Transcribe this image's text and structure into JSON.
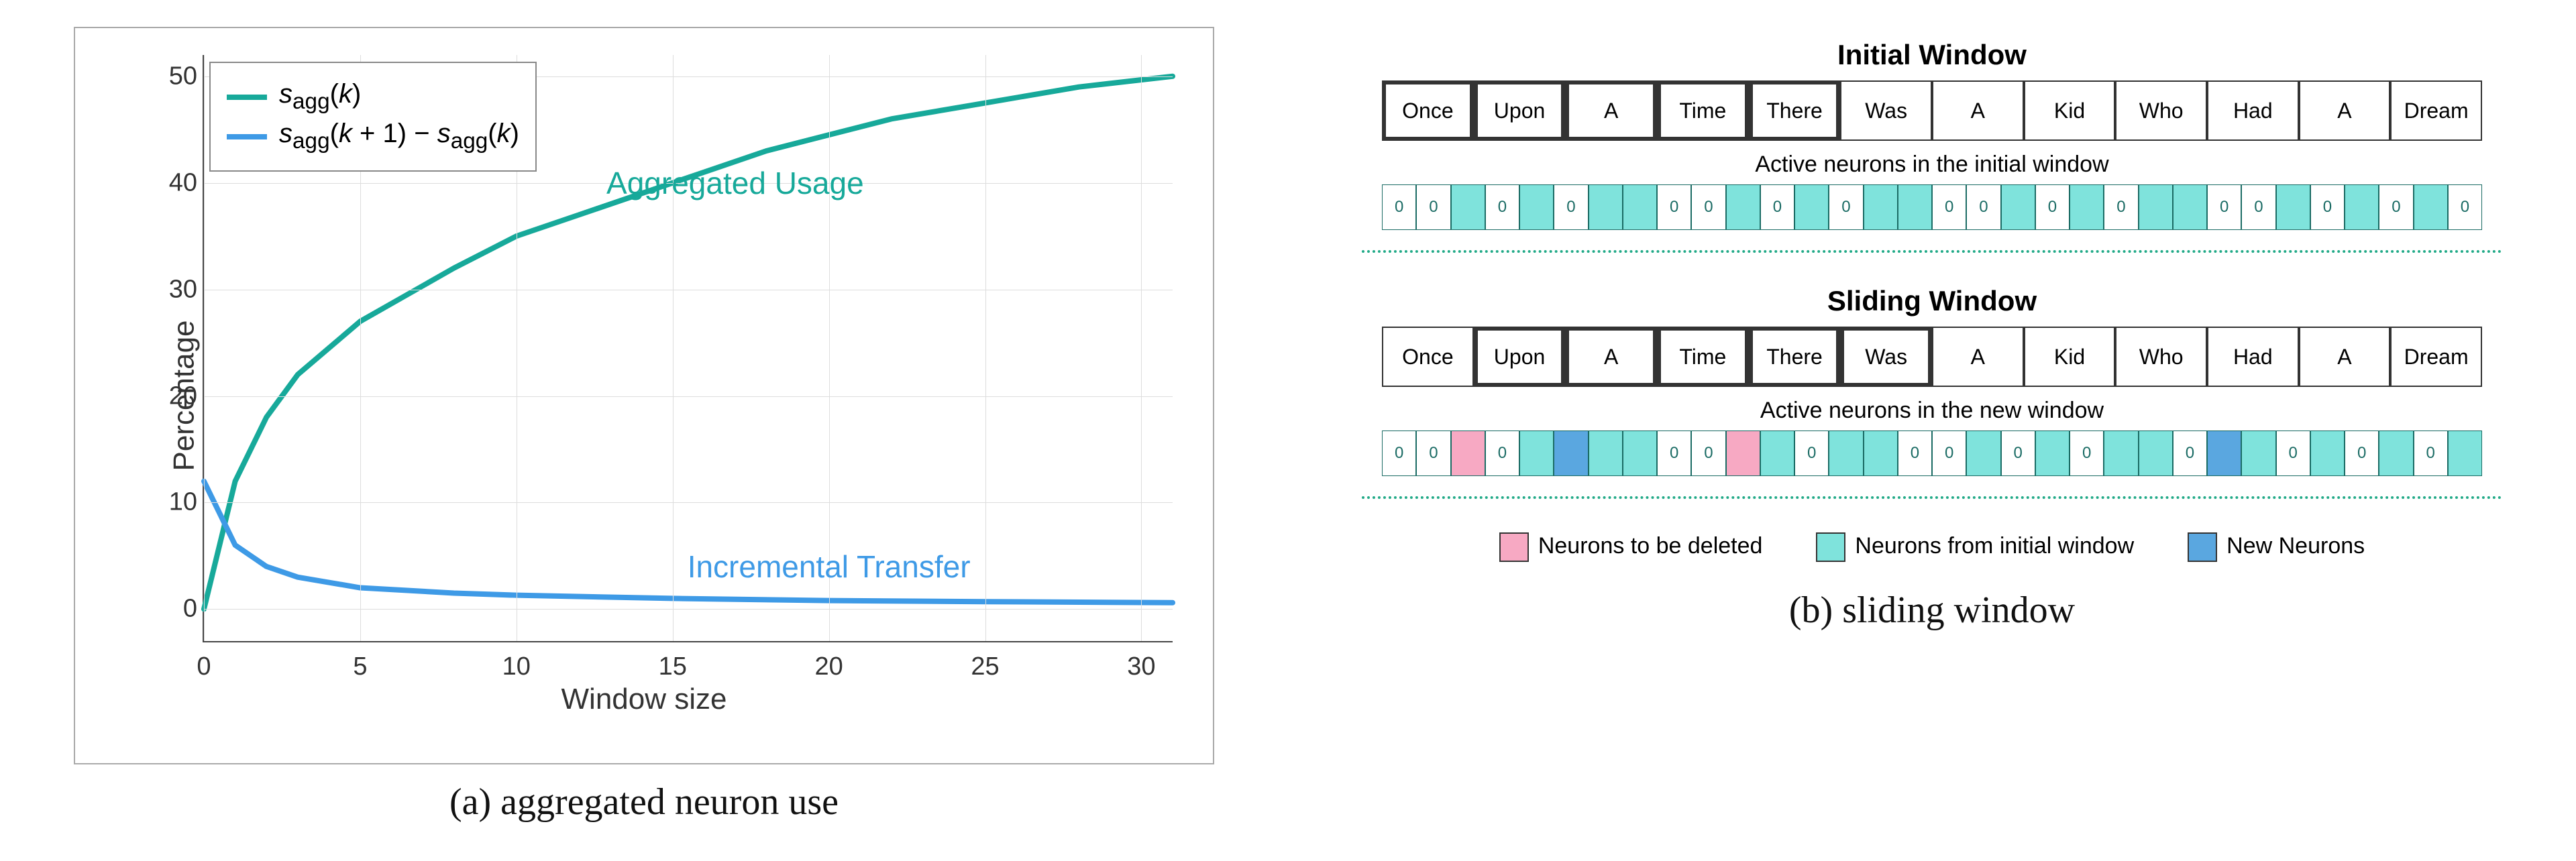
{
  "chart_data": {
    "type": "line",
    "title": "",
    "xlabel": "Window size",
    "ylabel": "Percentage",
    "xlim": [
      0,
      31
    ],
    "ylim": [
      -3,
      52
    ],
    "xticks": [
      0,
      5,
      10,
      15,
      20,
      25,
      30
    ],
    "yticks": [
      0,
      10,
      20,
      30,
      40,
      50
    ],
    "series": [
      {
        "name": "s_agg(k)",
        "color": "#17a99a",
        "values_x": [
          0,
          1,
          2,
          3,
          5,
          8,
          10,
          12,
          15,
          18,
          20,
          22,
          25,
          28,
          31
        ],
        "values_y": [
          0,
          12,
          18,
          22,
          27,
          32,
          35,
          37,
          40,
          43,
          44.5,
          46,
          47.5,
          49,
          50
        ]
      },
      {
        "name": "s_agg(k+1) - s_agg(k)",
        "color": "#3e9ae6",
        "values_x": [
          0,
          1,
          2,
          3,
          5,
          8,
          10,
          15,
          20,
          25,
          31
        ],
        "values_y": [
          12,
          6,
          4,
          3,
          2,
          1.5,
          1.3,
          1.0,
          0.8,
          0.7,
          0.6
        ]
      }
    ],
    "annotations": [
      {
        "text": "Aggregated Usage",
        "x": 17,
        "y": 40,
        "color": "#17a99a"
      },
      {
        "text": "Incremental Transfer",
        "x": 20,
        "y": 4,
        "color": "#3e9ae6"
      }
    ],
    "legend_entries": [
      "s_agg(k)",
      "s_agg(k+1) − s_agg(k)"
    ]
  },
  "captions": {
    "left": "(a) aggregated neuron use",
    "right": "(b) sliding window"
  },
  "right": {
    "title1": "Initial Window",
    "tokens": [
      "Once",
      "Upon",
      "A",
      "Time",
      "There",
      "Was",
      "A",
      "Kid",
      "Who",
      "Had",
      "A",
      "Dream"
    ],
    "hl1_start": 0,
    "hl1_end": 4,
    "sub1": "Active neurons in the initial window",
    "neurons1": [
      "0",
      "0",
      "",
      "0",
      "",
      "0",
      "",
      "",
      "0",
      "0",
      "",
      "0",
      "",
      "0",
      "",
      "",
      "0",
      "0",
      "",
      "0",
      "",
      "0",
      "",
      "",
      "0",
      "0",
      "",
      "0",
      "",
      "0",
      "",
      "0"
    ],
    "colors1": [
      "w",
      "w",
      "t",
      "w",
      "t",
      "w",
      "t",
      "t",
      "w",
      "w",
      "t",
      "w",
      "t",
      "w",
      "t",
      "t",
      "w",
      "w",
      "t",
      "w",
      "t",
      "w",
      "t",
      "t",
      "w",
      "w",
      "t",
      "w",
      "t",
      "w",
      "t",
      "w"
    ],
    "title2": "Sliding Window",
    "hl2_start": 1,
    "hl2_end": 5,
    "sub2": "Active neurons in the new window",
    "neurons2": [
      "0",
      "0",
      "",
      "0",
      "",
      "",
      "",
      "",
      "0",
      "0",
      "",
      "",
      "0",
      "",
      "",
      "0",
      "0",
      "",
      "0",
      "",
      "0",
      "",
      "",
      "0",
      "",
      "",
      "0",
      "",
      "0",
      "",
      "0",
      ""
    ],
    "colors2": [
      "w",
      "w",
      "p",
      "w",
      "t",
      "b",
      "t",
      "t",
      "w",
      "w",
      "p",
      "t",
      "w",
      "t",
      "t",
      "w",
      "w",
      "t",
      "w",
      "t",
      "w",
      "t",
      "t",
      "w",
      "b",
      "t",
      "w",
      "t",
      "w",
      "t",
      "w",
      "t"
    ],
    "legend": {
      "del": "Neurons to be deleted",
      "init": "Neurons from initial window",
      "new": "New Neurons"
    },
    "colors": {
      "teal": "#7fe3dc",
      "pink": "#f7a9c3",
      "blue": "#5aa7e0",
      "white": "#ffffff"
    }
  }
}
